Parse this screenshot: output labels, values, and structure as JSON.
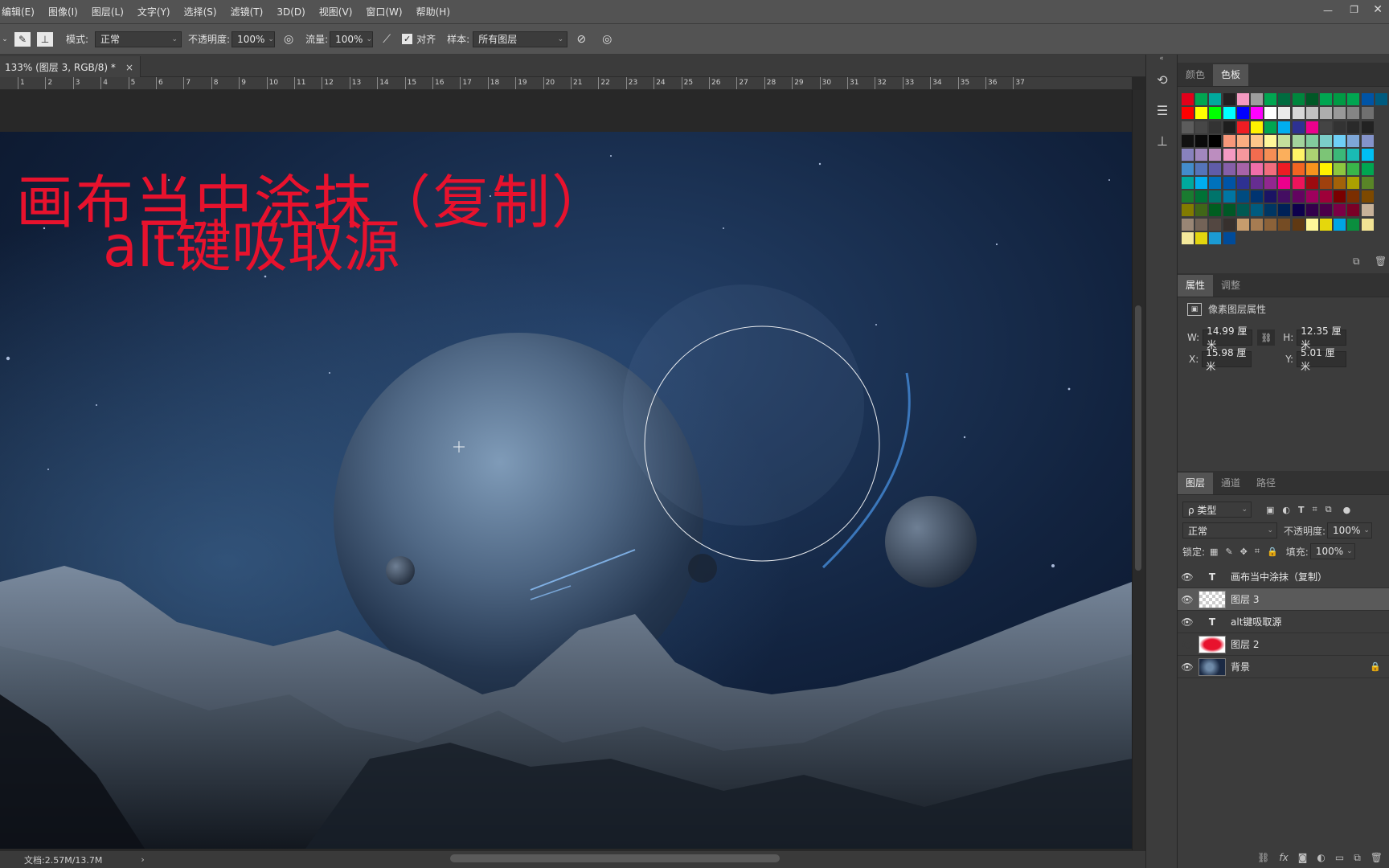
{
  "menu": [
    "编辑(E)",
    "图像(I)",
    "图层(L)",
    "文字(Y)",
    "选择(S)",
    "滤镜(T)",
    "3D(D)",
    "视图(V)",
    "窗口(W)",
    "帮助(H)"
  ],
  "options": {
    "mode_label": "模式:",
    "mode_value": "正常",
    "opacity_label": "不透明度:",
    "opacity_value": "100%",
    "flow_label": "流量:",
    "flow_value": "100%",
    "align_label": "对齐",
    "align_checked": true,
    "sample_label": "样本:",
    "sample_value": "所有图层"
  },
  "document_tab": {
    "title": "133% (图层 3, RGB/8) *",
    "close": "×"
  },
  "ruler_ticks": [
    "1",
    "2",
    "3",
    "4",
    "5",
    "6",
    "7",
    "8",
    "9",
    "10",
    "11",
    "12",
    "13",
    "14",
    "15",
    "16",
    "17",
    "18",
    "19",
    "20",
    "21",
    "22",
    "23",
    "24",
    "25",
    "26",
    "27",
    "28",
    "29",
    "30",
    "31",
    "32",
    "33",
    "34",
    "35",
    "36",
    "37"
  ],
  "canvas_text": {
    "line1": "画布当中涂抹（复制）",
    "line2": "alt键吸取源"
  },
  "status": {
    "doc_size": "文档:2.57M/13.7M",
    "arrow": "›"
  },
  "swatches_panel": {
    "tabs": [
      "颜色",
      "色板"
    ],
    "active_tab": "色板"
  },
  "properties_panel": {
    "tabs": [
      "属性",
      "调整"
    ],
    "active_tab": "属性",
    "header": "像素图层属性",
    "w_label": "W:",
    "w_value": "14.99 厘米",
    "h_label": "H:",
    "h_value": "12.35 厘米",
    "x_label": "X:",
    "x_value": "15.98 厘米",
    "y_label": "Y:",
    "y_value": "5.01 厘米"
  },
  "layers_panel": {
    "tabs": [
      "图层",
      "通道",
      "路径"
    ],
    "active_tab": "图层",
    "filter_label": "ρ 类型",
    "blend_mode": "正常",
    "opacity_label": "不透明度:",
    "opacity_value": "100%",
    "lock_label": "锁定:",
    "fill_label": "填充:",
    "fill_value": "100%",
    "layers": [
      {
        "name": "画布当中涂抹（复制）",
        "type": "text",
        "visible": true
      },
      {
        "name": "图层 3",
        "type": "pixel",
        "visible": true,
        "selected": true
      },
      {
        "name": "alt键吸取源",
        "type": "text",
        "visible": true
      },
      {
        "name": "图层 2",
        "type": "pixel",
        "visible": false
      },
      {
        "name": "背景",
        "type": "background",
        "visible": true,
        "locked": true
      }
    ],
    "footer_icons": [
      "link-icon",
      "fx-icon",
      "mask-icon",
      "adjustment-icon",
      "folder-icon",
      "new-layer-icon",
      "trash-icon"
    ]
  },
  "colors": {
    "canvas_text": "#e8122d",
    "panel_bg": "#3c3c3c",
    "menubar_bg": "#535353"
  }
}
